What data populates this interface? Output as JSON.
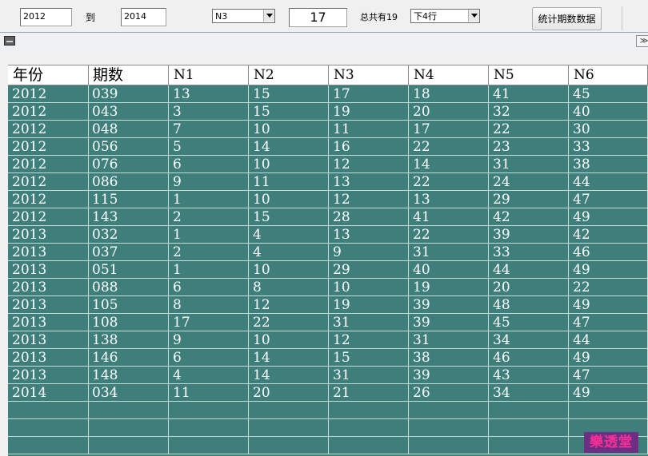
{
  "toolbar": {
    "start_year": "2012",
    "to_label": "到",
    "end_year": "2014",
    "column_select": "N3",
    "number_value": "17",
    "total_label": "总共有19",
    "rows_select": "下4行",
    "stats_button": "统计期数数据"
  },
  "subform": {
    "expand_glyph": "≫"
  },
  "table": {
    "columns": [
      "年份",
      "期数",
      "N1",
      "N2",
      "N3",
      "N4",
      "N5",
      "N6"
    ],
    "rows": [
      [
        "2012",
        "039",
        "13",
        "15",
        "17",
        "18",
        "41",
        "45"
      ],
      [
        "2012",
        "043",
        "3",
        "15",
        "19",
        "20",
        "32",
        "40"
      ],
      [
        "2012",
        "048",
        "7",
        "10",
        "11",
        "17",
        "22",
        "30"
      ],
      [
        "2012",
        "056",
        "5",
        "14",
        "16",
        "22",
        "23",
        "33"
      ],
      [
        "2012",
        "076",
        "6",
        "10",
        "12",
        "14",
        "31",
        "38"
      ],
      [
        "2012",
        "086",
        "9",
        "11",
        "13",
        "22",
        "24",
        "44"
      ],
      [
        "2012",
        "115",
        "1",
        "10",
        "12",
        "13",
        "29",
        "47"
      ],
      [
        "2012",
        "143",
        "2",
        "15",
        "28",
        "41",
        "42",
        "49"
      ],
      [
        "2013",
        "032",
        "1",
        "4",
        "13",
        "22",
        "39",
        "42"
      ],
      [
        "2013",
        "037",
        "2",
        "4",
        "9",
        "31",
        "33",
        "46"
      ],
      [
        "2013",
        "051",
        "1",
        "10",
        "29",
        "40",
        "44",
        "49"
      ],
      [
        "2013",
        "088",
        "6",
        "8",
        "10",
        "19",
        "20",
        "22"
      ],
      [
        "2013",
        "105",
        "8",
        "12",
        "19",
        "39",
        "48",
        "49"
      ],
      [
        "2013",
        "108",
        "17",
        "22",
        "31",
        "39",
        "45",
        "47"
      ],
      [
        "2013",
        "138",
        "9",
        "10",
        "12",
        "31",
        "34",
        "44"
      ],
      [
        "2013",
        "146",
        "6",
        "14",
        "15",
        "38",
        "46",
        "49"
      ],
      [
        "2013",
        "148",
        "4",
        "14",
        "31",
        "39",
        "43",
        "47"
      ],
      [
        "2014",
        "034",
        "11",
        "20",
        "21",
        "26",
        "34",
        "49"
      ]
    ]
  },
  "logo": {
    "text": "樂透堂"
  }
}
